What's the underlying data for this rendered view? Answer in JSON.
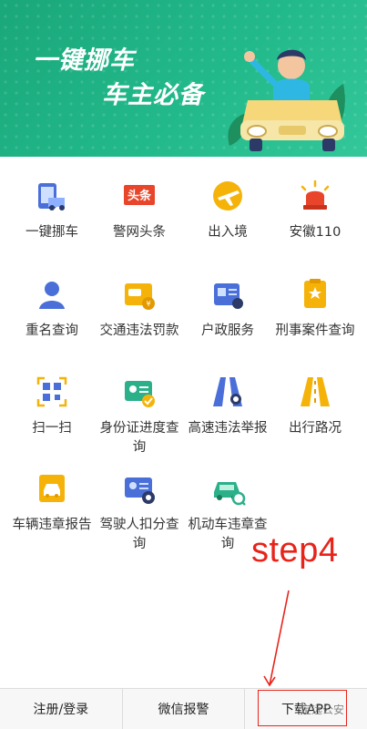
{
  "banner": {
    "slogan_line1": "一键挪车",
    "slogan_line2": "车主必备"
  },
  "grid_items": [
    {
      "label": "一键挪车",
      "icon": "phone-car-icon"
    },
    {
      "label": "警网头条",
      "icon": "headline-icon",
      "icon_text": "头条"
    },
    {
      "label": "出入境",
      "icon": "airplane-icon"
    },
    {
      "label": "安徽110",
      "icon": "police-light-icon"
    },
    {
      "label": "重名查询",
      "icon": "person-icon"
    },
    {
      "label": "交通违法罚款",
      "icon": "traffic-fine-icon"
    },
    {
      "label": "户政服务",
      "icon": "household-card-icon"
    },
    {
      "label": "刑事案件查询",
      "icon": "criminal-case-icon"
    },
    {
      "label": "扫一扫",
      "icon": "qr-scan-icon"
    },
    {
      "label": "身份证进度查询",
      "icon": "id-card-progress-icon"
    },
    {
      "label": "高速违法举报",
      "icon": "highway-report-icon"
    },
    {
      "label": "出行路况",
      "icon": "road-condition-icon"
    },
    {
      "label": "车辆违章报告",
      "icon": "vehicle-violation-icon"
    },
    {
      "label": "驾驶人扣分查询",
      "icon": "driver-points-icon"
    },
    {
      "label": "机动车违章查询",
      "icon": "motor-violation-icon"
    }
  ],
  "annotation": {
    "step_label": "step4"
  },
  "bottom_bar": {
    "tabs": [
      {
        "label": "注册/登录"
      },
      {
        "label": "微信报警"
      },
      {
        "label": "下载APP"
      }
    ]
  },
  "watermark": "定远公安",
  "colors": {
    "banner_green": "#22b98a",
    "icon_blue": "#4a6fd8",
    "icon_yellow": "#f5b30a",
    "icon_red": "#e8452a",
    "icon_green": "#2bb08a",
    "annotation_red": "#e8231a"
  }
}
